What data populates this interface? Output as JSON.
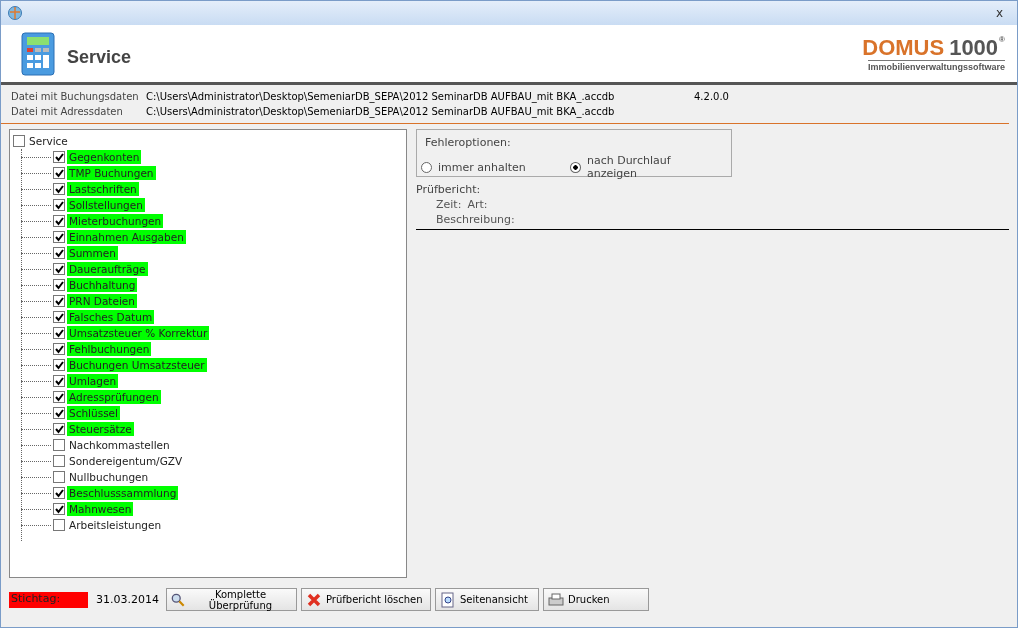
{
  "window": {
    "close": "x"
  },
  "header": {
    "title": "Service",
    "logo": {
      "word": "DOMUS",
      "number": "1000",
      "mark": "®",
      "tagline": "Immobilienverwaltungssoftware"
    }
  },
  "files": [
    {
      "label": "Datei mit Buchungsdaten",
      "path": "C:\\Users\\Administrator\\Desktop\\SemeniarDB_SEPA\\2012 SeminarDB AUFBAU_mit BKA_.accdb",
      "version": "4.2.0.0"
    },
    {
      "label": "Datei mit Adressdaten",
      "path": "C:\\Users\\Administrator\\Desktop\\SemeniarDB_SEPA\\2012 SeminarDB AUFBAU_mit BKA_.accdb"
    }
  ],
  "tree": {
    "label": "Service",
    "checked": false,
    "children": [
      {
        "label": "Gegenkonten",
        "checked": true
      },
      {
        "label": "TMP Buchungen",
        "checked": true
      },
      {
        "label": "Lastschriften",
        "checked": true
      },
      {
        "label": "Sollstellungen",
        "checked": true
      },
      {
        "label": "Mieterbuchungen",
        "checked": true
      },
      {
        "label": "Einnahmen Ausgaben",
        "checked": true
      },
      {
        "label": "Summen",
        "checked": true
      },
      {
        "label": "Daueraufträge",
        "checked": true
      },
      {
        "label": "Buchhaltung",
        "checked": true
      },
      {
        "label": "PRN Dateien",
        "checked": true
      },
      {
        "label": "Falsches Datum",
        "checked": true
      },
      {
        "label": "Umsatzsteuer % Korrektur",
        "checked": true
      },
      {
        "label": "Fehlbuchungen",
        "checked": true
      },
      {
        "label": "Buchungen Umsatzsteuer",
        "checked": true
      },
      {
        "label": "Umlagen",
        "checked": true
      },
      {
        "label": "Adressprüfungen",
        "checked": true
      },
      {
        "label": "Schlüssel",
        "checked": true
      },
      {
        "label": "Steuersätze",
        "checked": true
      },
      {
        "label": "Nachkommastellen",
        "checked": false
      },
      {
        "label": "Sondereigentum/GZV",
        "checked": false
      },
      {
        "label": "Nullbuchungen",
        "checked": false
      },
      {
        "label": "Beschlusssammlung",
        "checked": true
      },
      {
        "label": "Mahnwesen",
        "checked": true
      },
      {
        "label": "Arbeitsleistungen",
        "checked": false
      }
    ]
  },
  "error_options": {
    "title": "Fehleroptionen:",
    "options": [
      {
        "label": "immer anhalten",
        "selected": false
      },
      {
        "label": "nach Durchlauf anzeigen",
        "selected": true
      }
    ]
  },
  "report": {
    "title": "Prüfbericht:",
    "time": "Zeit:",
    "type": "Art:",
    "description": "Beschreibung:"
  },
  "footer": {
    "date_label": "Stichtag:",
    "date": "31.03.2014",
    "buttons": [
      {
        "kind": "search",
        "label": "Komplette Überprüfung"
      },
      {
        "kind": "delete",
        "label": "Prüfbericht löschen"
      },
      {
        "kind": "preview",
        "label": "Seitenansicht"
      },
      {
        "kind": "print",
        "label": "Drucken"
      }
    ]
  }
}
